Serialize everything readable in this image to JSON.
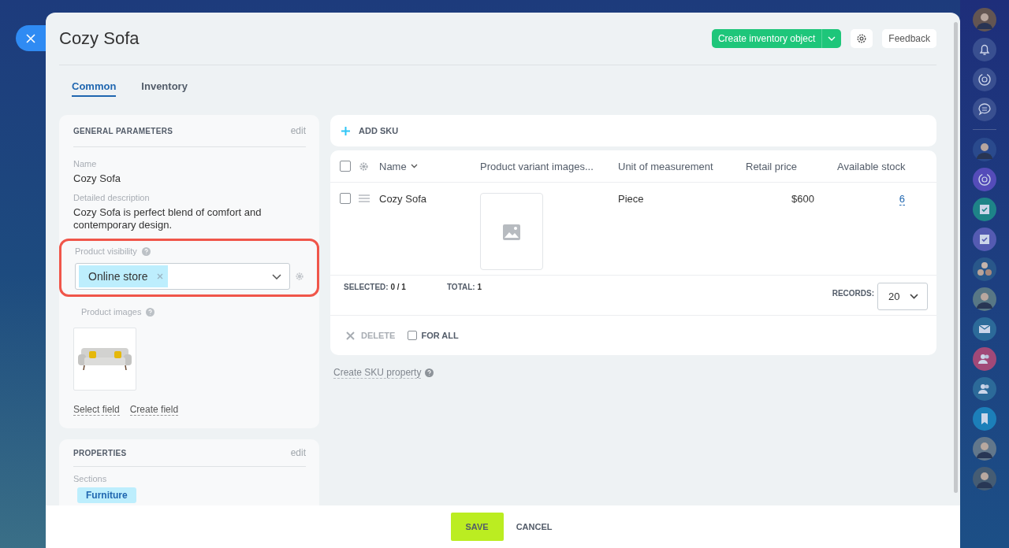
{
  "title": "Cozy Sofa",
  "header_buttons": {
    "create": "Create inventory object",
    "feedback": "Feedback"
  },
  "tabs": [
    {
      "label": "Common",
      "selected": true
    },
    {
      "label": "Inventory",
      "selected": false
    }
  ],
  "general_parameters": {
    "heading": "GENERAL PARAMETERS",
    "edit": "edit",
    "fields": [
      {
        "label": "Name",
        "value": "Cozy Sofa"
      },
      {
        "label": "Detailed description",
        "value": "Cozy Sofa is perfect blend of comfort and contemporary design."
      }
    ],
    "visibility": {
      "label": "Product visibility",
      "tags": [
        "Online store"
      ],
      "highlighted": true
    },
    "images": {
      "label": "Product images"
    },
    "links": [
      "Select field",
      "Create field"
    ]
  },
  "properties": {
    "heading": "PROPERTIES",
    "edit": "edit",
    "sections_label": "Sections",
    "tags": [
      "Furniture"
    ]
  },
  "sku": {
    "add": "ADD SKU",
    "header_checked": false,
    "columns": [
      "Name",
      "Product variant images...",
      "Unit of measurement",
      "Retail price",
      "Available stock"
    ],
    "rows": [
      {
        "checked": false,
        "name": "Cozy Sofa",
        "unit": "Piece",
        "price": "$600",
        "stock": "6"
      }
    ],
    "selected_label": "SELECTED:",
    "selected_value": "0 / 1",
    "total_label": "TOTAL:",
    "total_value": "1",
    "records_label": "RECORDS:",
    "records_value": "20",
    "delete": "DELETE",
    "for_all": "FOR ALL",
    "for_all_checked": false,
    "create_property": "Create SKU property"
  },
  "footer": {
    "save": "SAVE",
    "cancel": "CANCEL"
  }
}
